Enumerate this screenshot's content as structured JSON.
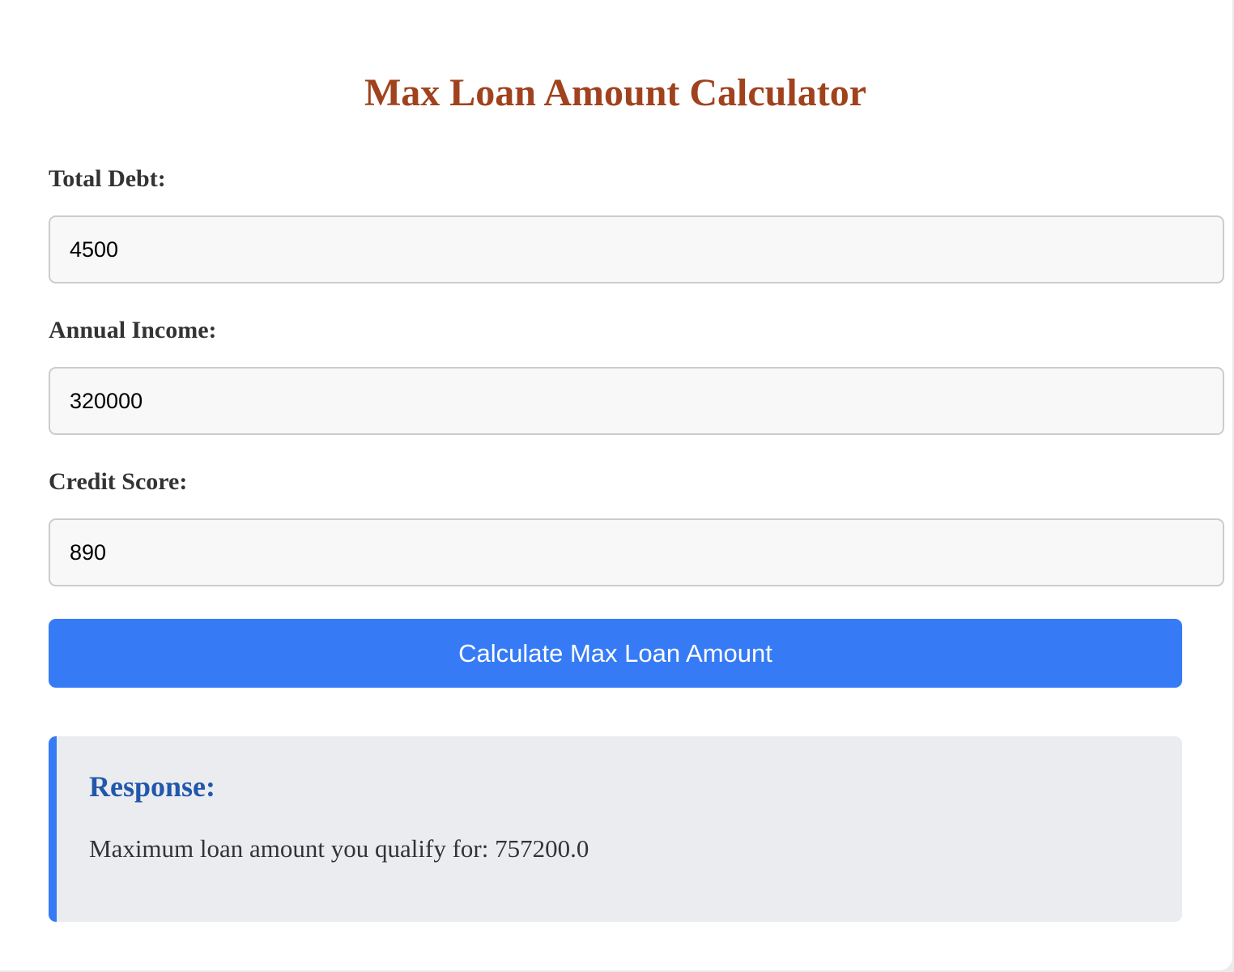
{
  "page": {
    "title": "Max Loan Amount Calculator"
  },
  "form": {
    "total_debt": {
      "label": "Total Debt:",
      "value": "4500"
    },
    "annual_income": {
      "label": "Annual Income:",
      "value": "320000"
    },
    "credit_score": {
      "label": "Credit Score:",
      "value": "890"
    },
    "submit_label": "Calculate Max Loan Amount"
  },
  "response": {
    "title": "Response:",
    "text": "Maximum loan amount you qualify for: 757200.0"
  },
  "colors": {
    "title": "#a0421d",
    "accent": "#367bf5",
    "response_title": "#2258aa",
    "response_bg": "#ebecf0"
  }
}
